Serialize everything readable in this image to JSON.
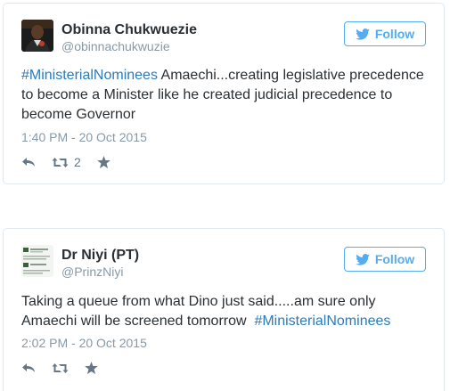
{
  "tweets": [
    {
      "display_name": "Obinna Chukwuezie",
      "handle": "@obinnachukwuzie",
      "follow_label": "Follow",
      "hashtag": "#MinisterialNominees",
      "text_after_hashtag": " Amaechi...creating legislative precedence to become a Minister like he created judicial precedence to become Governor",
      "timestamp": "1:40 PM - 20 Oct 2015",
      "retweet_count": "2"
    },
    {
      "display_name": "Dr Niyi (PT)",
      "handle": "@PrinzNiyi",
      "follow_label": "Follow",
      "text_before_hashtag": "Taking a queue from what Dino just said.....am sure only Amaechi will be screened tomorrow  ",
      "hashtag": "#MinisterialNominees",
      "timestamp": "2:02 PM - 20 Oct 2015"
    }
  ],
  "colors": {
    "accent": "#55acee",
    "hashtag": "#2b7bb9",
    "muted": "#8899a6",
    "text": "#292f33",
    "border": "#e1e8ed"
  },
  "icons": [
    "twitter-bird-icon",
    "reply-icon",
    "retweet-icon",
    "favorite-star-icon"
  ]
}
